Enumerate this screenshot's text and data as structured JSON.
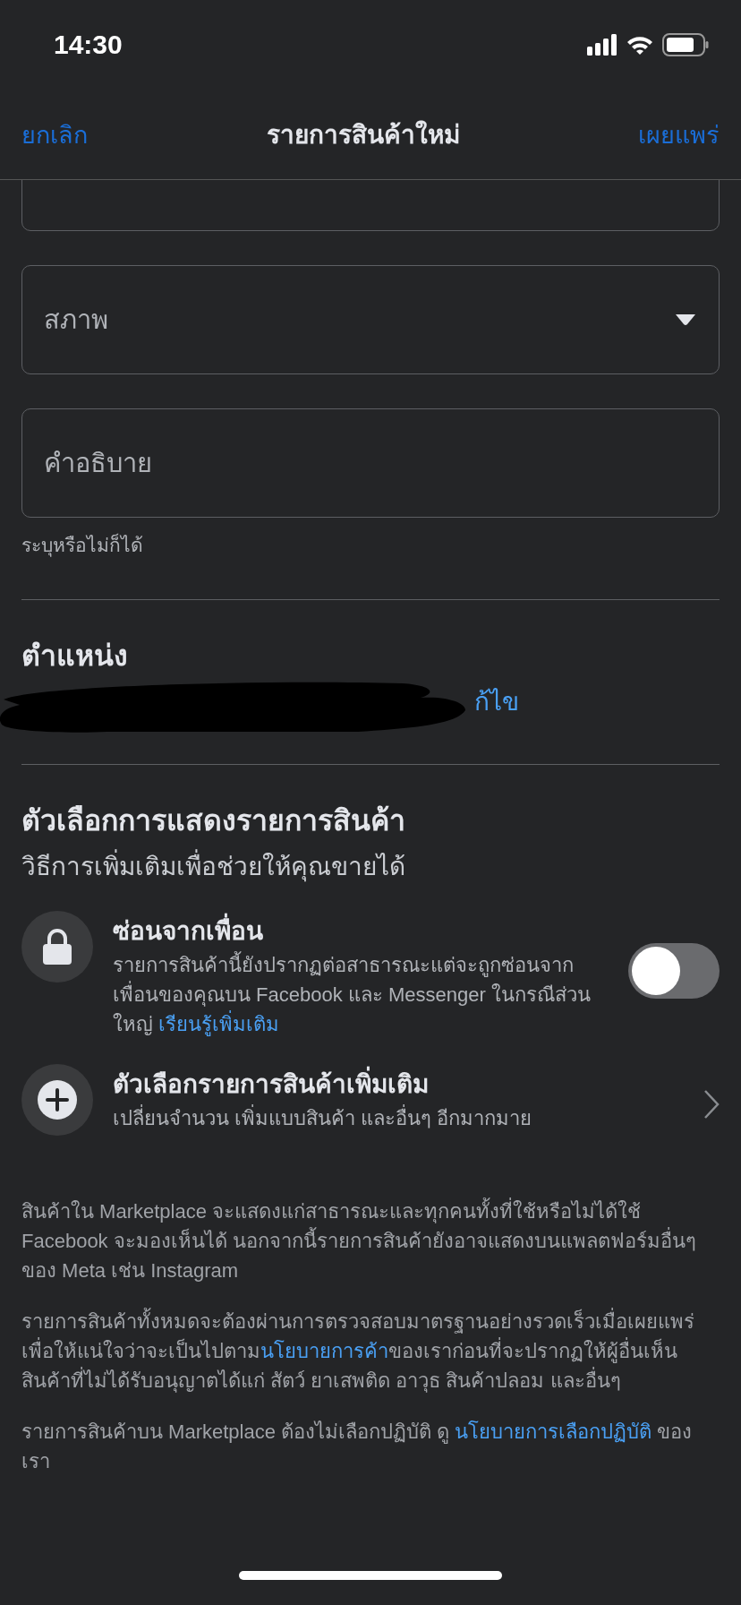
{
  "status_bar": {
    "time": "14:30"
  },
  "nav": {
    "cancel": "ยกเลิก",
    "title": "รายการสินค้าใหม่",
    "publish": "เผยแพร่"
  },
  "fields": [
    {
      "kind": "cut"
    },
    {
      "kind": "dropdown",
      "placeholder": "สภาพ"
    },
    {
      "kind": "text",
      "placeholder": "คำอธิบาย",
      "hint": "ระบุหรือไม่ก็ได้"
    }
  ],
  "location": {
    "title": "ตำแหน่ง",
    "edit_link": "ก้ไข"
  },
  "options_section": {
    "title": "ตัวเลือกการแสดงรายการสินค้า",
    "subtitle": "วิธีการเพิ่มเติมเพื่อช่วยให้คุณขายได้",
    "items": [
      {
        "kind": "toggle",
        "title": "ซ่อนจากเพื่อน",
        "description": "รายการสินค้านี้ยังปรากฏต่อสาธารณะแต่จะถูกซ่อนจากเพื่อนของคุณบน Facebook และ Messenger ในกรณีส่วนใหญ่ ",
        "link": "เรียนรู้เพิ่มเติม",
        "on": false
      },
      {
        "kind": "nav",
        "title": "ตัวเลือกรายการสินค้าเพิ่มเติม",
        "description": "เปลี่ยนจำนวน เพิ่มแบบสินค้า และอื่นๆ อีกมากมาย"
      }
    ]
  },
  "notices": [
    {
      "parts": [
        {
          "text": "สินค้าใน Marketplace จะแสดงแก่สาธารณะและทุกคนทั้งที่ใช้หรือไม่ได้ใช้ Facebook จะมองเห็นได้ นอกจากนี้รายการสินค้ายังอาจแสดงบนแพลตฟอร์มอื่นๆ ของ Meta เช่น Instagram",
          "link": false
        }
      ]
    },
    {
      "parts": [
        {
          "text": "รายการสินค้าทั้งหมดจะต้องผ่านการตรวจสอบมาตรฐานอย่างรวดเร็วเมื่อเผยแพร่เพื่อให้แน่ใจว่าจะเป็นไปตาม",
          "link": false
        },
        {
          "text": "นโยบายการค้า",
          "link": true
        },
        {
          "text": "ของเราก่อนที่จะปรากฏให้ผู้อื่นเห็น สินค้าที่ไม่ได้รับอนุญาตได้แก่ สัตว์ ยาเสพติด อาวุธ สินค้าปลอม และอื่นๆ",
          "link": false
        }
      ]
    },
    {
      "parts": [
        {
          "text": "รายการสินค้าบน Marketplace ต้องไม่เลือกปฏิบัติ ดู ",
          "link": false
        },
        {
          "text": "นโยบายการเลือกปฏิบัติ",
          "link": true
        },
        {
          "text": " ของเรา",
          "link": false
        }
      ]
    }
  ]
}
